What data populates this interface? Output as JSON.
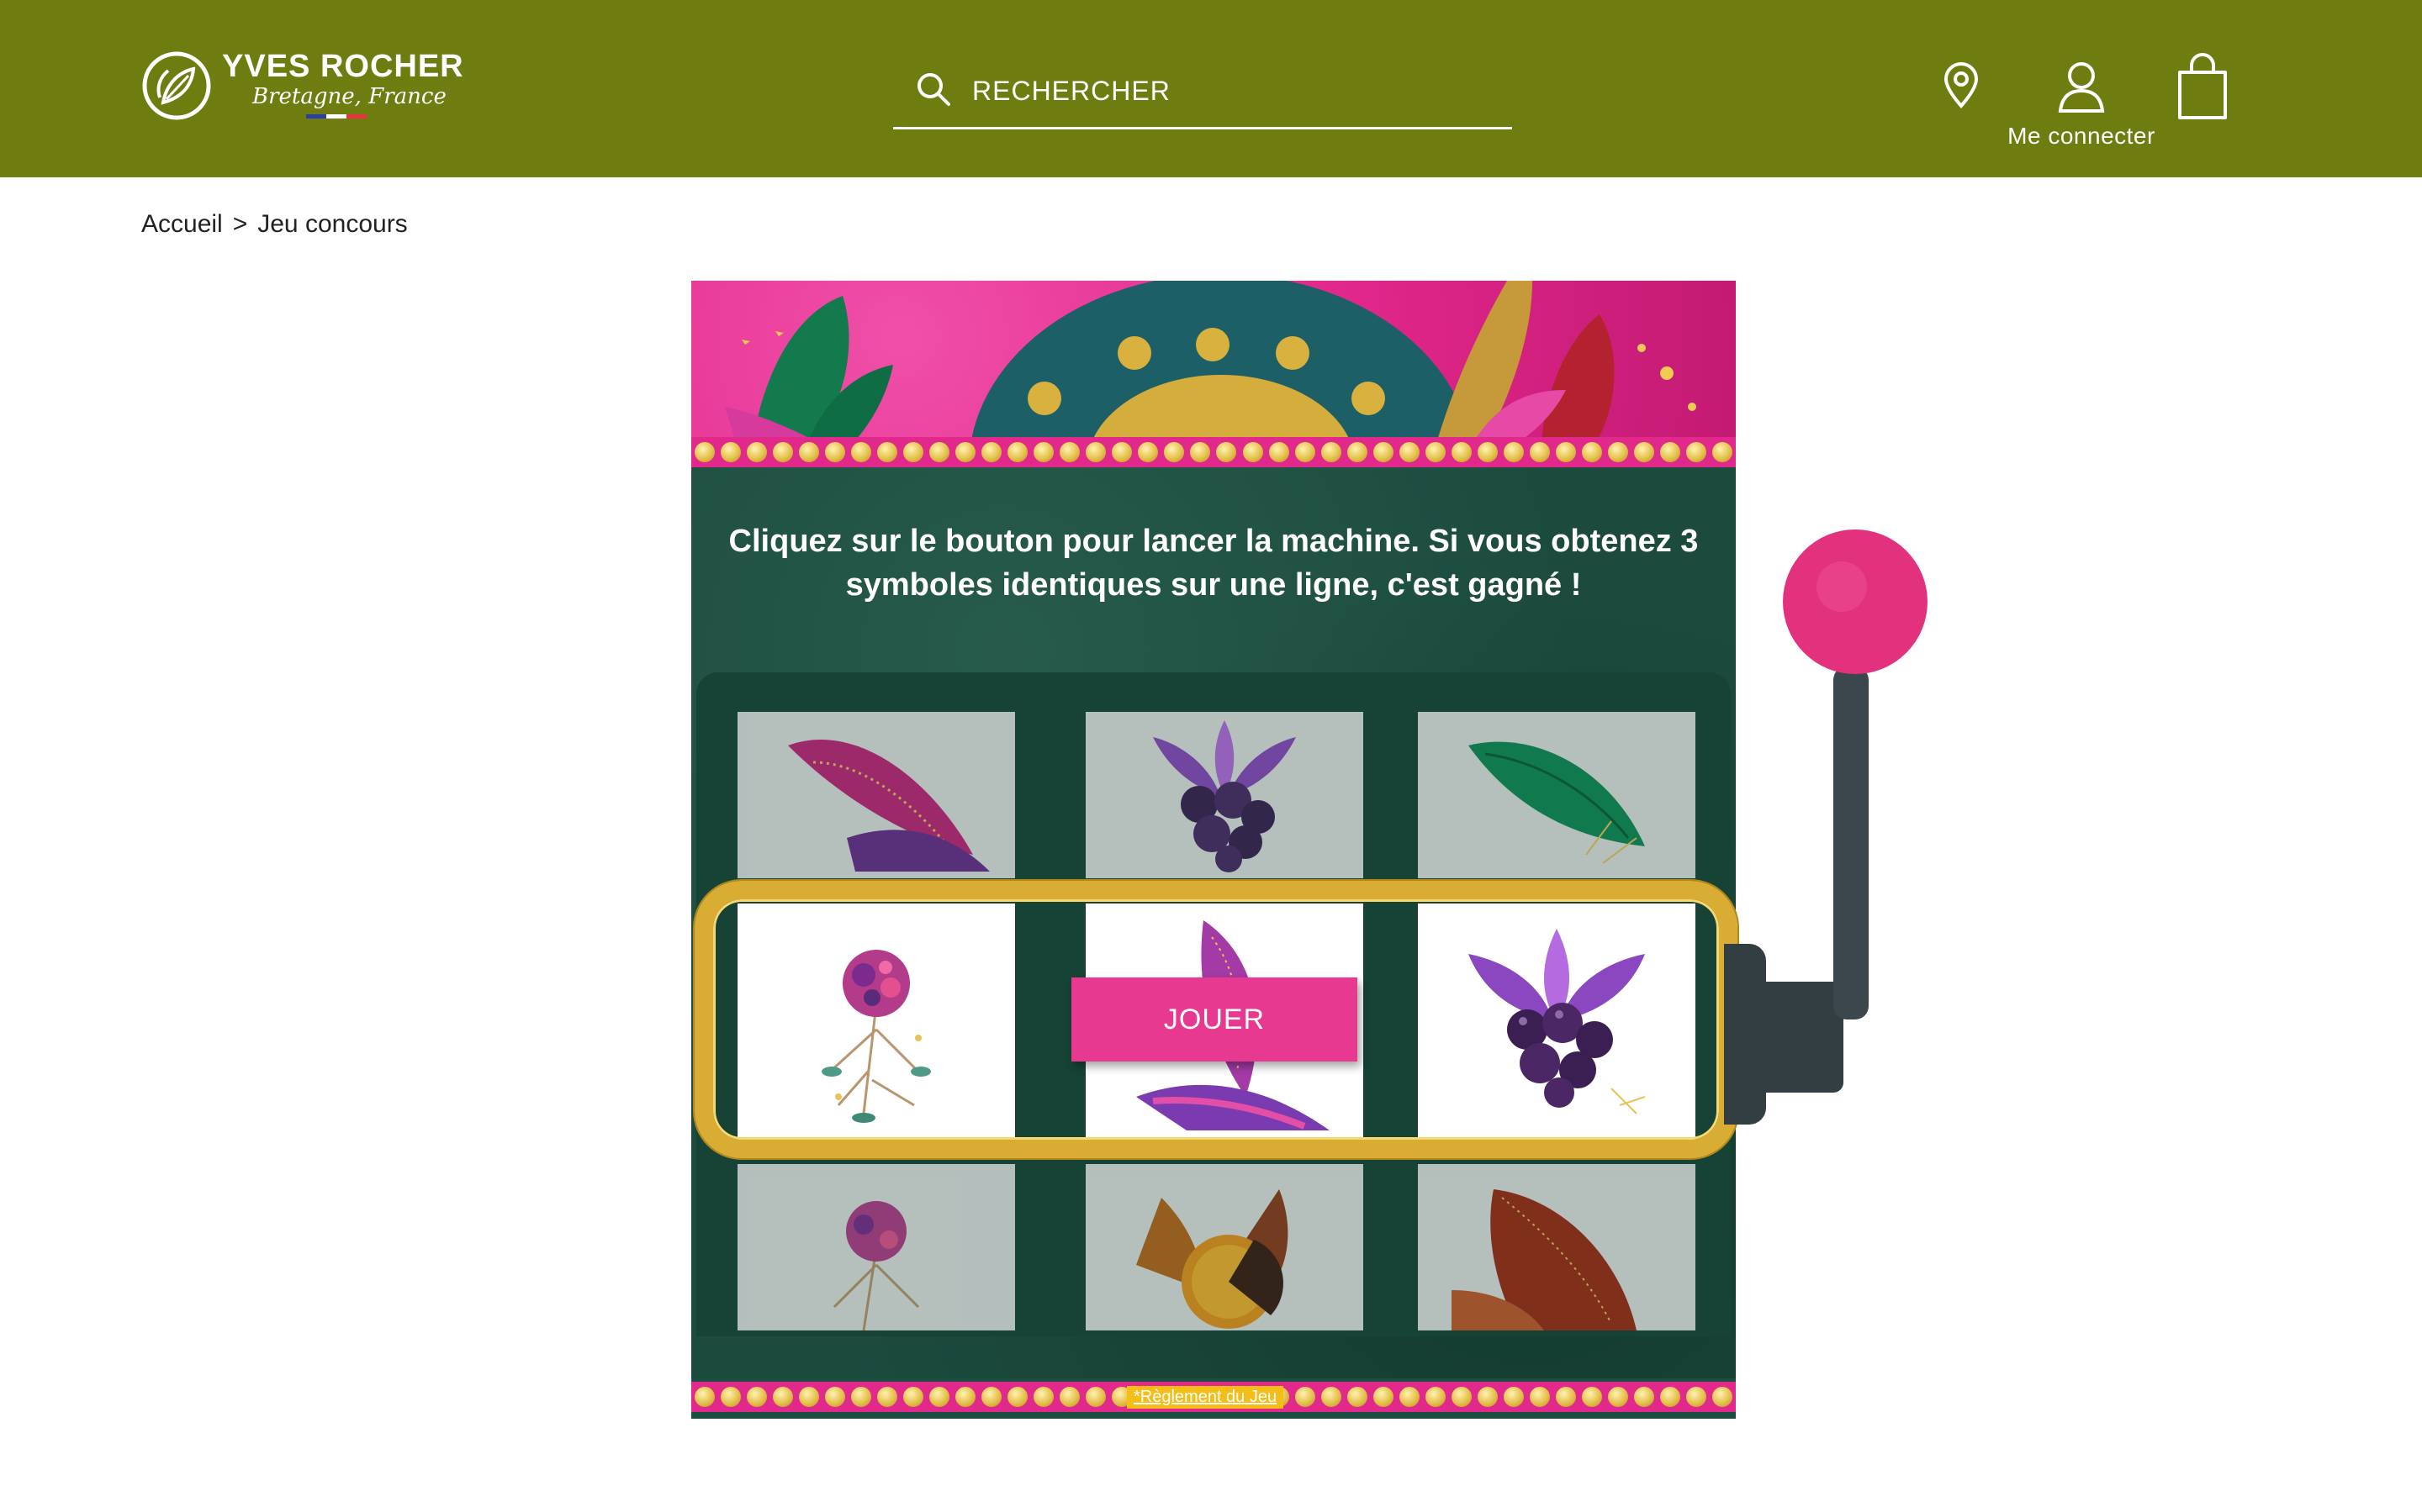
{
  "header": {
    "brand": "YVES ROCHER",
    "tagline": "Bretagne, France",
    "search_placeholder": "RECHERCHER",
    "account_label": "Me connecter",
    "colors": {
      "background": "#6e7c10",
      "text": "#ffffff"
    },
    "icons": [
      "store-locator-icon",
      "user-icon",
      "shopping-bag-icon",
      "search-icon"
    ]
  },
  "breadcrumb": {
    "home": "Accueil",
    "separator": ">",
    "current": "Jeu concours"
  },
  "game": {
    "instructions": "Cliquez sur le bouton pour lancer la machine. Si vous obtenez 3 symboles identiques sur une ligne, c'est gagné !",
    "play_button": "JOUER",
    "rules_link": "*Règlement du Jeu",
    "colors": {
      "primary": "#e6398f",
      "board": "#1c4b3e",
      "gold": "#d9ad33",
      "rules_badge": "#f5bd18"
    },
    "reels": [
      {
        "top": "pink-feather-leaf",
        "middle": "pink-flower-bouquet",
        "bottom": "pink-flower-bouquet"
      },
      {
        "top": "blackberry",
        "middle": "purple-feather-leaf",
        "bottom": "orange-slice"
      },
      {
        "top": "green-leaf",
        "middle": "blackberry",
        "bottom": "red-leaf"
      }
    ]
  }
}
